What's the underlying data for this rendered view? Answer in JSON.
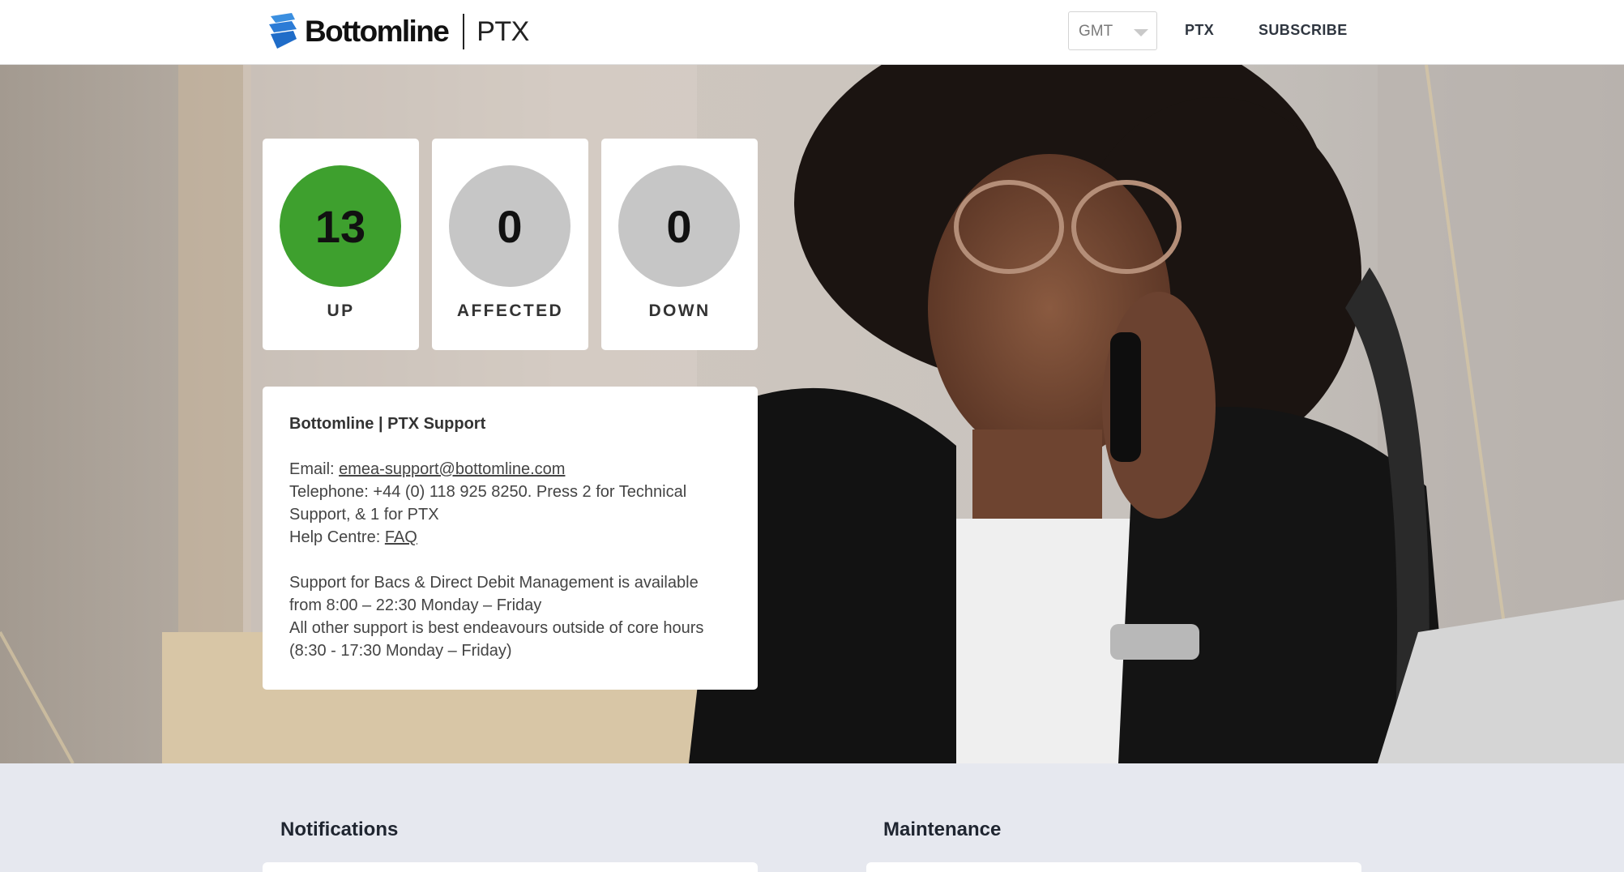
{
  "header": {
    "brand": "Bottomline",
    "product": "PTX",
    "timezone": {
      "value": "GMT"
    },
    "nav": [
      {
        "label": "PTX"
      },
      {
        "label": "SUBSCRIBE"
      }
    ]
  },
  "status": [
    {
      "count": "13",
      "label": "UP",
      "color": "#3ea02e"
    },
    {
      "count": "0",
      "label": "AFFECTED",
      "color": "#c6c6c6"
    },
    {
      "count": "0",
      "label": "DOWN",
      "color": "#c6c6c6"
    }
  ],
  "support": {
    "title": "Bottomline | PTX Support",
    "email_prefix": "Email: ",
    "email": "emea-support@bottomline.com",
    "telephone": "Telephone: +44 (0) 118 925 8250. Press 2 for Technical Support, & 1 for PTX",
    "help_prefix": "Help Centre: ",
    "help_link": "FAQ",
    "hours_1": "Support for Bacs & Direct Debit Management is available from 8:00 – 22:30 Monday – Friday",
    "hours_2": "All other support is best endeavours outside of core hours (8:30 - 17:30 Monday – Friday)"
  },
  "sections": {
    "notifications": "Notifications",
    "maintenance": "Maintenance"
  },
  "icons": {
    "logo": "bottomline-logo-icon",
    "caret": "chevron-down-icon"
  }
}
